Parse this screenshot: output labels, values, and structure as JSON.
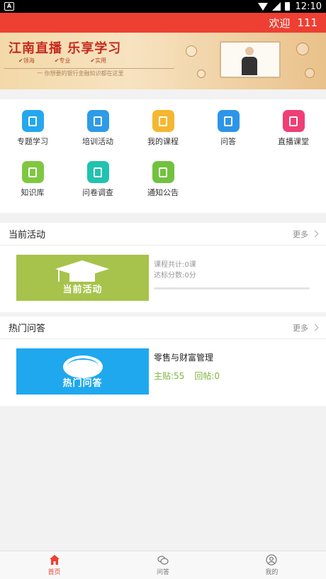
{
  "status_bar": {
    "time": "12:10"
  },
  "header": {
    "welcome": "欢迎",
    "user": "111",
    "color": "#ee3f33"
  },
  "banner": {
    "title": "江南直播 乐享学习",
    "tags": [
      "✔领海",
      "✔专业",
      "✔实用"
    ],
    "subtitle": "一 你想要的银行金融知识都在这里"
  },
  "grid": {
    "items": [
      {
        "label": "专题学习",
        "color": "#25a7ee",
        "icon": "bag-icon"
      },
      {
        "label": "培训活动",
        "color": "#2d9be6",
        "icon": "edit-board-icon"
      },
      {
        "label": "我的课程",
        "color": "#f5b731",
        "icon": "star-doc-icon"
      },
      {
        "label": "问答",
        "color": "#2d95e8",
        "icon": "chat-icon"
      },
      {
        "label": "直播课堂",
        "color": "#f03f74",
        "icon": "tv-icon"
      },
      {
        "label": "知识库",
        "color": "#7fc741",
        "icon": "cap-icon"
      },
      {
        "label": "问卷调查",
        "color": "#21c2b0",
        "icon": "list-icon"
      },
      {
        "label": "通知公告",
        "color": "#71c23f",
        "icon": "notice-icon"
      }
    ]
  },
  "activity": {
    "title": "当前活动",
    "more": "更多",
    "thumb_label": "当前活动",
    "course_total": "课程共计:0课",
    "score": "达标分数:0分",
    "progress": 0
  },
  "qa": {
    "title": "热门问答",
    "more": "更多",
    "thumb_label": "热门问答",
    "item_title": "零售与财富管理",
    "main_posts": "主贴:55",
    "replies": "回帖:0"
  },
  "bottom_nav": {
    "items": [
      {
        "label": "首页",
        "icon": "home-icon",
        "active": true
      },
      {
        "label": "问答",
        "icon": "chat-bubbles-icon",
        "active": false
      },
      {
        "label": "我的",
        "icon": "user-icon",
        "active": false
      }
    ]
  }
}
